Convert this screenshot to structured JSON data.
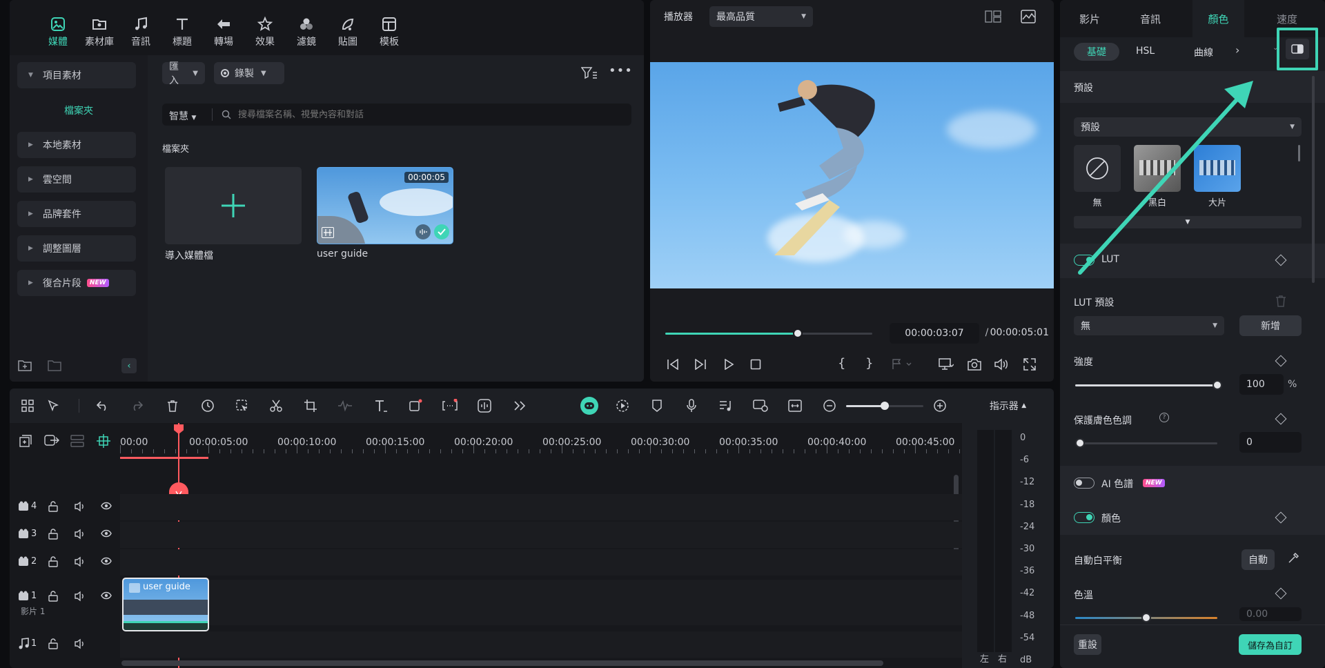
{
  "media_tabs": [
    {
      "label": "媒體",
      "icon": "media-icon",
      "active": true
    },
    {
      "label": "素材庫",
      "icon": "stock-icon",
      "active": false
    },
    {
      "label": "音訊",
      "icon": "music-note-icon",
      "active": false
    },
    {
      "label": "標題",
      "icon": "title-t-icon",
      "active": false
    },
    {
      "label": "轉場",
      "icon": "transition-icon",
      "active": false
    },
    {
      "label": "效果",
      "icon": "effects-star-icon",
      "active": false
    },
    {
      "label": "濾鏡",
      "icon": "filters-icon",
      "active": false
    },
    {
      "label": "貼圖",
      "icon": "stickers-icon",
      "active": false
    },
    {
      "label": "模板",
      "icon": "templates-icon",
      "active": false
    }
  ],
  "sidebar": {
    "project_media": "項目素材",
    "folder": "檔案夾",
    "items": [
      {
        "label": "本地素材"
      },
      {
        "label": "雲空間"
      },
      {
        "label": "品牌套件"
      },
      {
        "label": "調整圖層"
      },
      {
        "label": "復合片段",
        "badge": "NEW"
      }
    ]
  },
  "media_main": {
    "import_label": "匯入",
    "record_label": "錄製",
    "smart_label": "智慧",
    "search_placeholder": "搜尋檔案名稱、視覺內容和對話",
    "folder_heading": "檔案夾",
    "import_tile_label": "導入媒體檔",
    "clip": {
      "name": "user guide",
      "duration": "00:00:05"
    }
  },
  "player": {
    "label": "播放器",
    "quality": "最高品質",
    "current_time": "00:00:03:07",
    "separator": "/",
    "total_time": "00:00:05:01",
    "progress": 0.64
  },
  "props": {
    "tabs": [
      "影片",
      "音訊",
      "顏色",
      "速度"
    ],
    "active_tab": "顏色",
    "subtabs": [
      "基礎",
      "HSL",
      "曲線"
    ],
    "preset_section": "預設",
    "preset_dropdown": "預設",
    "presets": [
      {
        "label": "無"
      },
      {
        "label": "黑白"
      },
      {
        "label": "大片"
      }
    ],
    "lut_label": "LUT",
    "lut_preset_label": "LUT 預設",
    "lut_preset_value": "無",
    "add_label": "新增",
    "intensity_label": "強度",
    "intensity_value": "100",
    "intensity_unit": "%",
    "skin_label": "保護膚色色調",
    "skin_value": "0",
    "ai_label": "AI 色譜",
    "ai_badge": "NEW",
    "color_label": "顏色",
    "awb_label": "自動白平衡",
    "auto_label": "自動",
    "temp_label": "色溫",
    "temp_value": "0.00",
    "reset_label": "重設",
    "save_label": "儲存為自訂"
  },
  "timeline": {
    "meter_label": "指示器",
    "ticks": [
      "00:00",
      "00:00:05:00",
      "00:00:10:00",
      "00:00:15:00",
      "00:00:20:00",
      "00:00:25:00",
      "00:00:30:00",
      "00:00:35:00",
      "00:00:40:00",
      "00:00:45:00"
    ],
    "tracks": [
      {
        "num": "4"
      },
      {
        "num": "3"
      },
      {
        "num": "2"
      },
      {
        "num": "1",
        "name": "影片 1"
      }
    ],
    "audio_track": {
      "num": "1"
    },
    "clip_label": "user guide",
    "db_scale": [
      "0",
      "-6",
      "-12",
      "-18",
      "-24",
      "-30",
      "-36",
      "-42",
      "-48",
      "-54",
      "dB"
    ],
    "left_label": "左",
    "right_label": "右"
  },
  "colors": {
    "accent": "#3fd5b6",
    "playhead": "#ff5a5f",
    "panel": "#1d1f24"
  }
}
